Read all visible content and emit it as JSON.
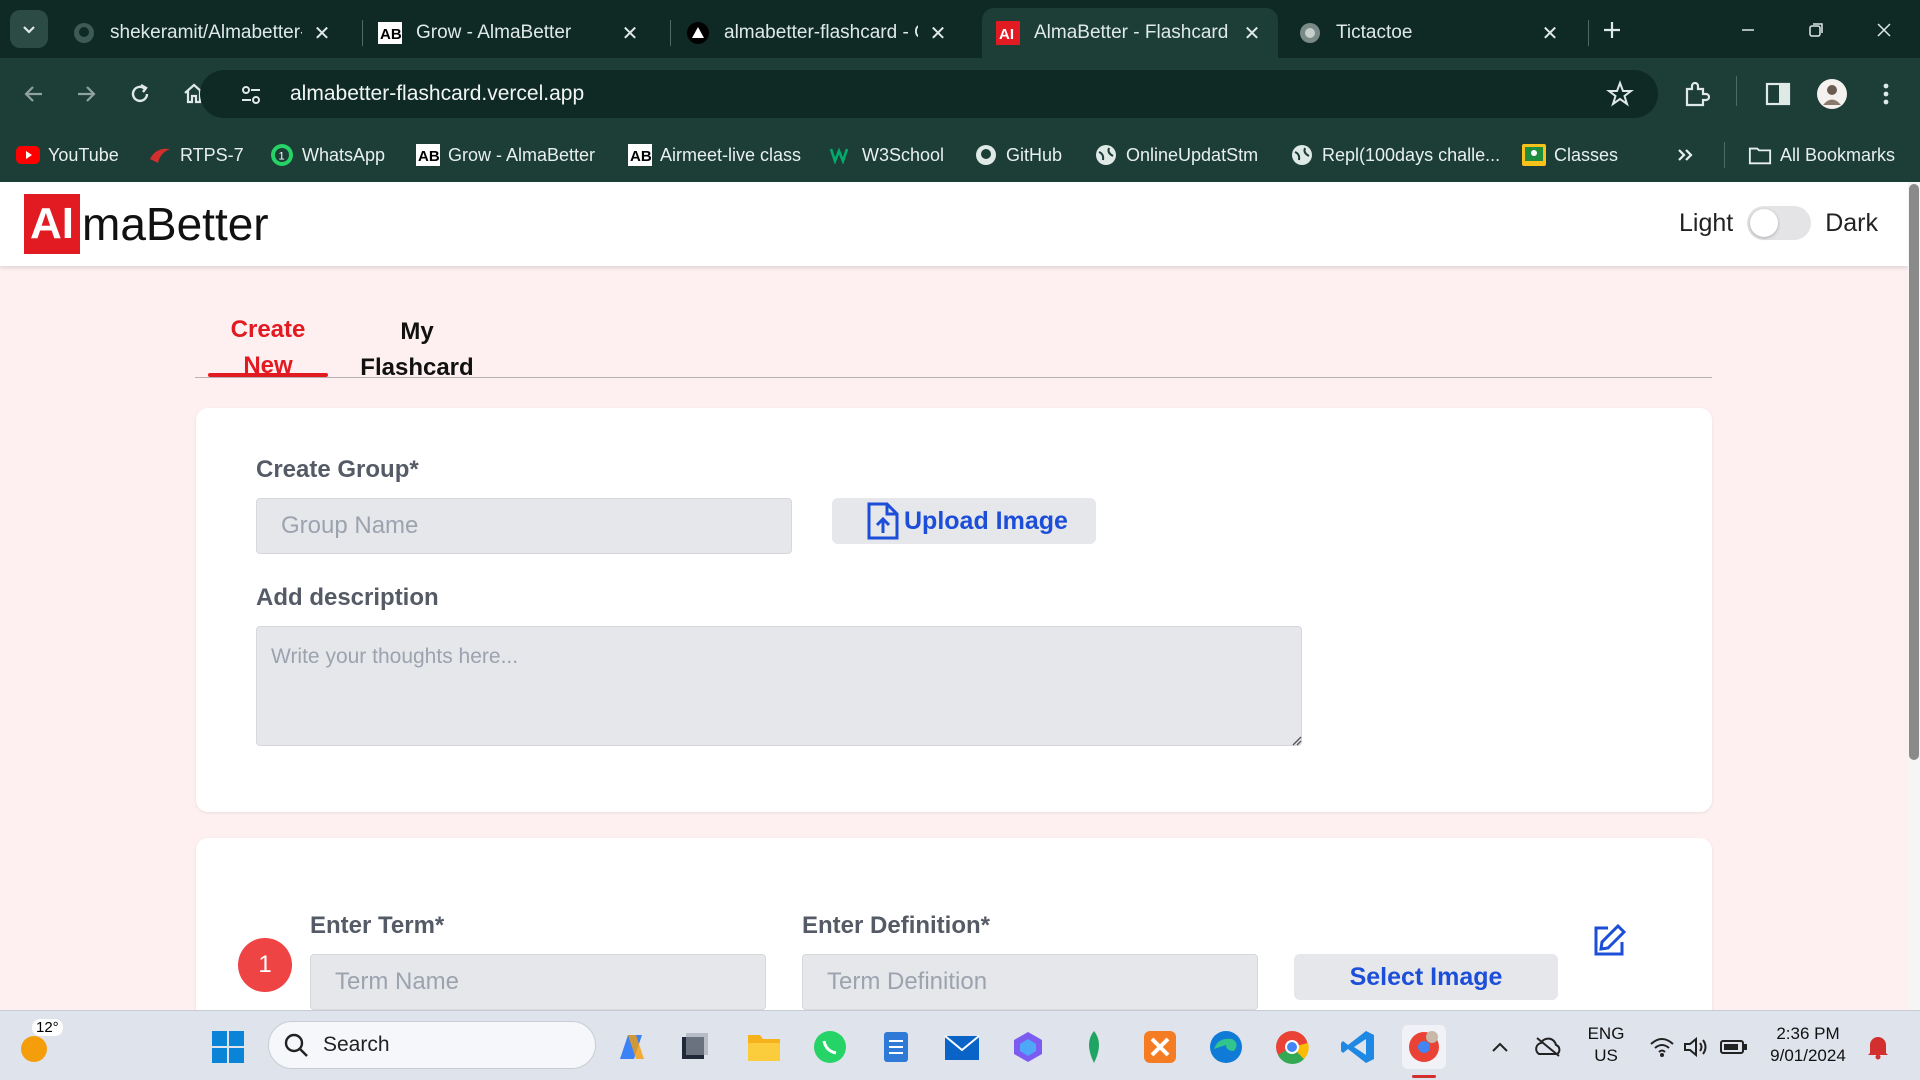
{
  "browser": {
    "tabs": [
      {
        "title": "shekeramit/Almabetter-F",
        "icon": "github-icon"
      },
      {
        "title": "Grow - AlmaBetter",
        "icon": "almabetter-ab-icon"
      },
      {
        "title": "almabetter-flashcard - O",
        "icon": "vercel-icon"
      },
      {
        "title": "AlmaBetter - Flashcard G",
        "icon": "almabetter-ai-icon",
        "active": true
      },
      {
        "title": "Tictactoe",
        "icon": "globe-icon"
      }
    ],
    "url": "almabetter-flashcard.vercel.app",
    "bookmarks": [
      {
        "label": "YouTube",
        "icon": "youtube-icon"
      },
      {
        "label": "RTPS-7",
        "icon": "rtps-icon"
      },
      {
        "label": "WhatsApp",
        "icon": "whatsapp-icon"
      },
      {
        "label": "Grow - AlmaBetter",
        "icon": "almabetter-ab-icon"
      },
      {
        "label": "Airmeet-live class",
        "icon": "almabetter-ab-icon"
      },
      {
        "label": "W3School",
        "icon": "w3school-icon"
      },
      {
        "label": "GitHub",
        "icon": "github-icon"
      },
      {
        "label": "OnlineUpdatStm",
        "icon": "globe-icon"
      },
      {
        "label": "Repl(100days challe...",
        "icon": "globe-icon"
      },
      {
        "label": "Classes",
        "icon": "classroom-icon"
      }
    ],
    "all_bookmarks": "All Bookmarks",
    "colors": {
      "frame": "#0f2a25",
      "toolbar": "#1d3d37"
    }
  },
  "site": {
    "logo_box": "AI",
    "logo_text": "maBetter",
    "theme_light": "Light",
    "theme_dark": "Dark",
    "dark_mode": false
  },
  "tabs": {
    "create_line1": "Create",
    "create_line2": "New",
    "my_line1": "My",
    "my_line2": "Flashcard"
  },
  "group_form": {
    "group_label": "Create Group*",
    "group_placeholder": "Group Name",
    "upload_label": "Upload Image",
    "desc_label": "Add description",
    "desc_placeholder": "Write your thoughts here..."
  },
  "term_form": {
    "number": "1",
    "term_label": "Enter Term*",
    "term_placeholder": "Term Name",
    "def_label": "Enter Definition*",
    "def_placeholder": "Term Definition",
    "select_image": "Select Image"
  },
  "colors": {
    "brand_red": "#e21a22",
    "link_blue": "#1d4ed8",
    "page_bg": "#fef0f0",
    "badge_red": "#ef4444"
  },
  "taskbar": {
    "weather": "12°",
    "search": "Search",
    "lang1": "ENG",
    "lang2": "US",
    "time": "2:36 PM",
    "date": "9/01/2024"
  }
}
